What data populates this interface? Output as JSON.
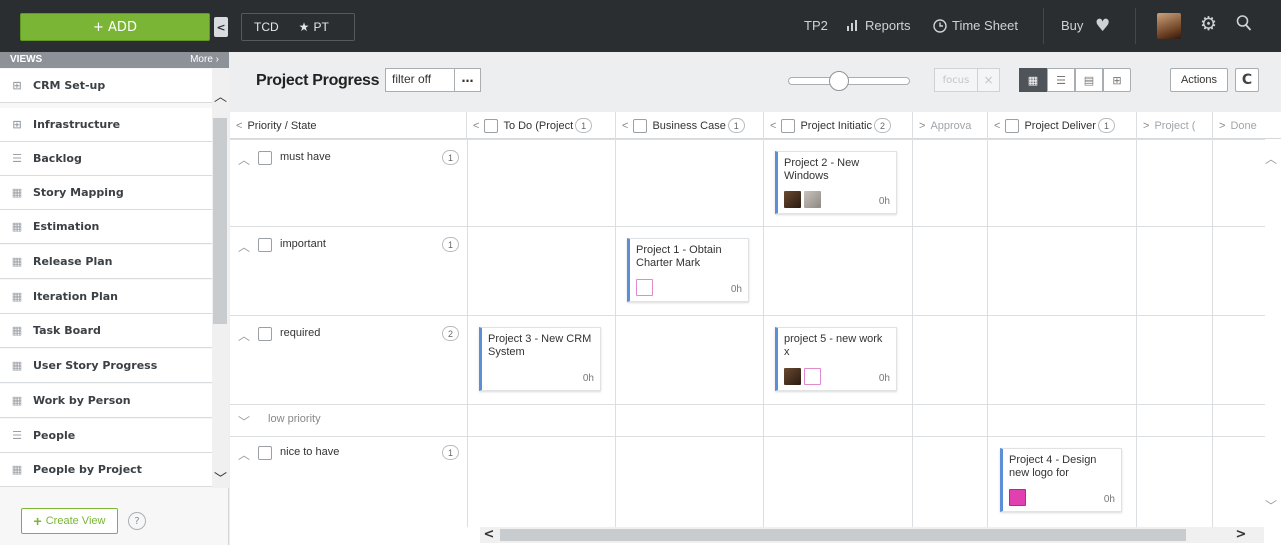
{
  "topbar": {
    "add_label": "+ ADD",
    "collapse_icon": "chevron-left-icon",
    "tag_tcd": "TCD",
    "tag_pt": "PT",
    "tp2": "TP2",
    "reports": "Reports",
    "timesheet": "Time Sheet",
    "buy": "Buy"
  },
  "sidebar": {
    "views_label": "VIEWS",
    "more_label": "More ›",
    "items": [
      {
        "label": "CRM Set-up",
        "icon": "hierarchy-icon"
      },
      {
        "label": "Infrastructure",
        "icon": "hierarchy-lock-icon"
      },
      {
        "label": "Backlog",
        "icon": "list-icon"
      },
      {
        "label": "Story Mapping",
        "icon": "board-icon"
      },
      {
        "label": "Estimation",
        "icon": "board-icon"
      },
      {
        "label": "Release Plan",
        "icon": "board-icon"
      },
      {
        "label": "Iteration Plan",
        "icon": "board-icon"
      },
      {
        "label": "Task Board",
        "icon": "board-icon"
      },
      {
        "label": "User Story Progress",
        "icon": "board-icon"
      },
      {
        "label": "Work by Person",
        "icon": "board-icon"
      },
      {
        "label": "People",
        "icon": "list-icon"
      },
      {
        "label": "People by Project",
        "icon": "board-icon"
      }
    ],
    "create_view": "Create View",
    "help": "?"
  },
  "toolbar": {
    "title": "Project Progress",
    "filter": "filter off",
    "filter_more": "…",
    "focus": "focus",
    "focus_x": "×",
    "actions": "Actions",
    "refresh": "C"
  },
  "board": {
    "corner_label": "Priority / State",
    "columns": [
      {
        "label": "To Do (Project",
        "count": "1"
      },
      {
        "label": "Business Case",
        "count": "1"
      },
      {
        "label": "Project Initiatic",
        "count": "2"
      },
      {
        "label": "Approva",
        "count": ""
      },
      {
        "label": "Project Deliver",
        "count": "1"
      },
      {
        "label": "Project (",
        "count": ""
      },
      {
        "label": "Done",
        "count": ""
      }
    ],
    "rows": [
      {
        "label": "must have",
        "count": "1"
      },
      {
        "label": "important",
        "count": "1"
      },
      {
        "label": "required",
        "count": "2"
      },
      {
        "label": "low priority",
        "count": ""
      },
      {
        "label": "nice to have",
        "count": "1"
      }
    ],
    "cards": [
      {
        "title": "Project 2 - New Windows",
        "hours": "0h"
      },
      {
        "title": "Project 1 - Obtain Charter Mark",
        "hours": "0h"
      },
      {
        "title": "Project 3 - New CRM System",
        "hours": "0h"
      },
      {
        "title": "project 5 - new work x",
        "hours": "0h"
      },
      {
        "title": "Project 4 - Design new logo for",
        "hours": "0h"
      }
    ]
  },
  "colors": {
    "topbar": "#2b2e31",
    "add_green": "#7ab535",
    "card_accent": "#5b8fd6"
  }
}
